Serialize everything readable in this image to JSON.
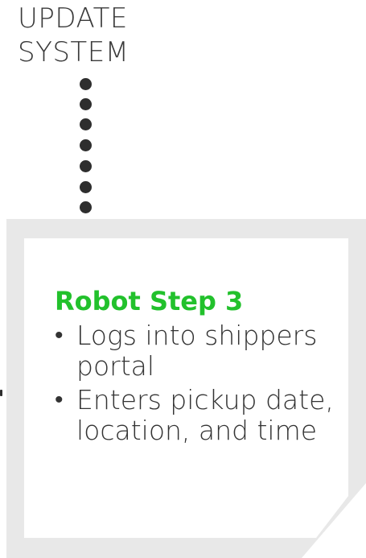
{
  "top_label": {
    "line1": "UPDATE",
    "line2": "SYSTEM"
  },
  "colors": {
    "title_green": "#22c12c",
    "card_border": "#e8e8e8",
    "dots": "#2e2e2e",
    "text": "#333333"
  },
  "card": {
    "title": "Robot Step 3",
    "bullets": [
      {
        "marker": "•",
        "text": "Logs into shippers portal"
      },
      {
        "marker": "•",
        "text": "Enters pickup date, location, and time"
      }
    ]
  }
}
